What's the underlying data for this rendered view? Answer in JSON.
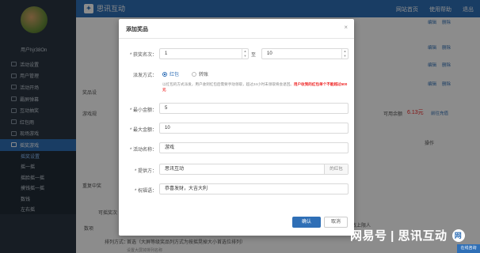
{
  "topbar": {
    "logo_text": "思讯互动",
    "links": [
      "网站首页",
      "使用帮助",
      "退出"
    ]
  },
  "sidebar": {
    "username": "用户hjr38On",
    "items": [
      {
        "label": "活动设置",
        "active": false
      },
      {
        "label": "用户管理",
        "active": false
      },
      {
        "label": "活动开场",
        "active": false
      },
      {
        "label": "霸屏弹幕",
        "active": false
      },
      {
        "label": "互动抽奖",
        "active": false
      },
      {
        "label": "红包雨",
        "active": false
      },
      {
        "label": "现场游戏",
        "active": false
      },
      {
        "label": "摇奖游戏",
        "active": true
      }
    ],
    "subitems": [
      "摇奖设置",
      "摇一摇",
      "摇脸摇一摇",
      "摸钱摇一摇",
      "数钱",
      "左右摇"
    ]
  },
  "background": {
    "row_actions": [
      "编辑",
      "删除"
    ],
    "section_label_1": "奖品设",
    "section_label_2": "游戏规",
    "amount_label": "可用余额",
    "amount": "6.13元",
    "recharge": "前往充值",
    "operation_header": "操作",
    "label_3": "重复中奖",
    "label_4": "可摇奖次",
    "label_5": "数项",
    "sort_label": "排列方式：",
    "sort_text": "首选（大屏等级奖品列方式为按摇晃掉大小首选位排列）",
    "sort_hint": "设置大屏掉排列名称",
    "people_text": "人数上限人"
  },
  "modal": {
    "title": "添加奖品",
    "close": "×",
    "rank_label": "* 获奖名次：",
    "rank_from": "1",
    "rank_sep": "至",
    "rank_to": "10",
    "method_label": "派发方式：",
    "method_options": [
      "红包",
      "转账"
    ],
    "method_selected": "红包",
    "method_hint": "以红包的方式派发，用户收到红包后需要手动领取，超过24小时未领取将会退回。",
    "method_hint_red": "用户收到的红包单个不能超过500元",
    "min_label": "* 最小金额：",
    "min_value": "5",
    "max_label": "* 最大金额：",
    "max_value": "10",
    "activity_label": "* 活动名称：",
    "activity_value": "游戏",
    "provider_label": "* 提供方：",
    "provider_value": "思讯互动",
    "provider_addon": "的红包",
    "blessing_label": "* 祝福语：",
    "blessing_value": "恭喜发财，大吉大利",
    "ok_label": "确认",
    "cancel_label": "取消"
  },
  "watermark": {
    "icon": "网",
    "text": "网易号 | 思讯互动"
  },
  "corner_badge": "在线咨询"
}
